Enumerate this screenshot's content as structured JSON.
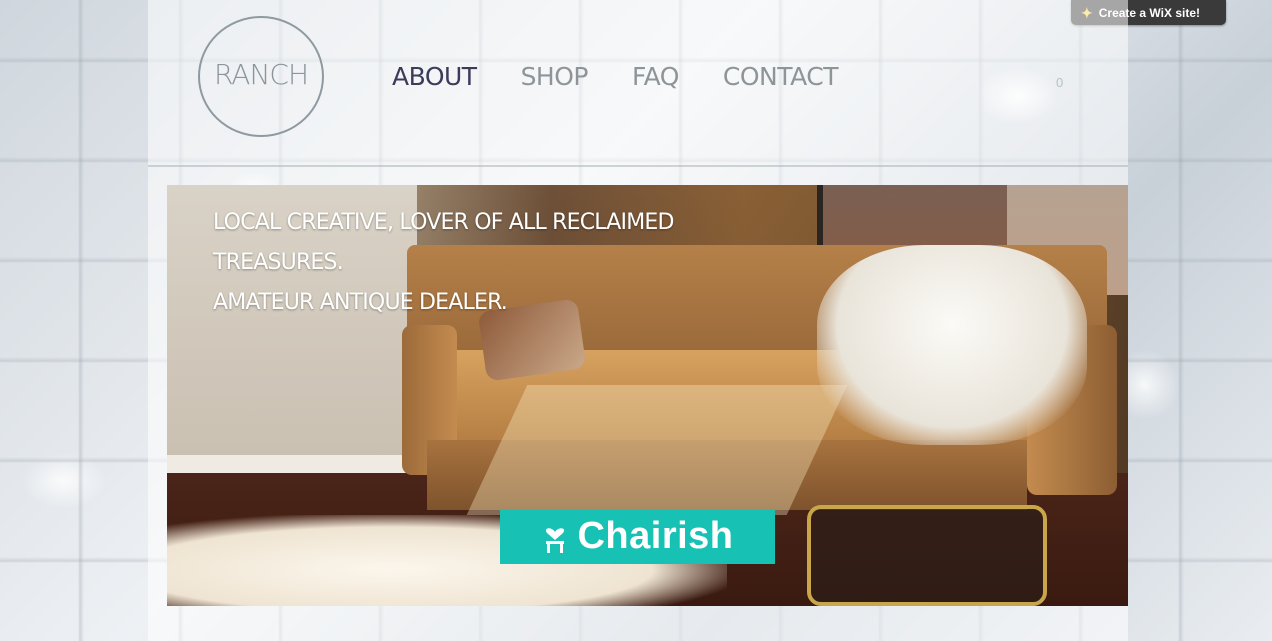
{
  "wix_badge": {
    "label": "Create a WiX site!",
    "icon": "wix-star-icon"
  },
  "logo": {
    "text": "RANCH"
  },
  "nav": {
    "items": [
      {
        "label": "ABOUT",
        "active": true
      },
      {
        "label": "SHOP",
        "active": false
      },
      {
        "label": "FAQ",
        "active": false
      },
      {
        "label": "CONTACT",
        "active": false
      }
    ]
  },
  "cart": {
    "count": "0"
  },
  "hero": {
    "lines": [
      "Local creative, lover of all reclaimed",
      "treasures.",
      "Amateur antique dealer."
    ]
  },
  "chairish_button": {
    "label": "Chairish",
    "icon": "chair-heart-icon",
    "color": "#17c1b4"
  },
  "colors": {
    "nav_active": "#3c3c5a",
    "nav_inactive": "#8e9599",
    "logo": "#8a969c"
  }
}
